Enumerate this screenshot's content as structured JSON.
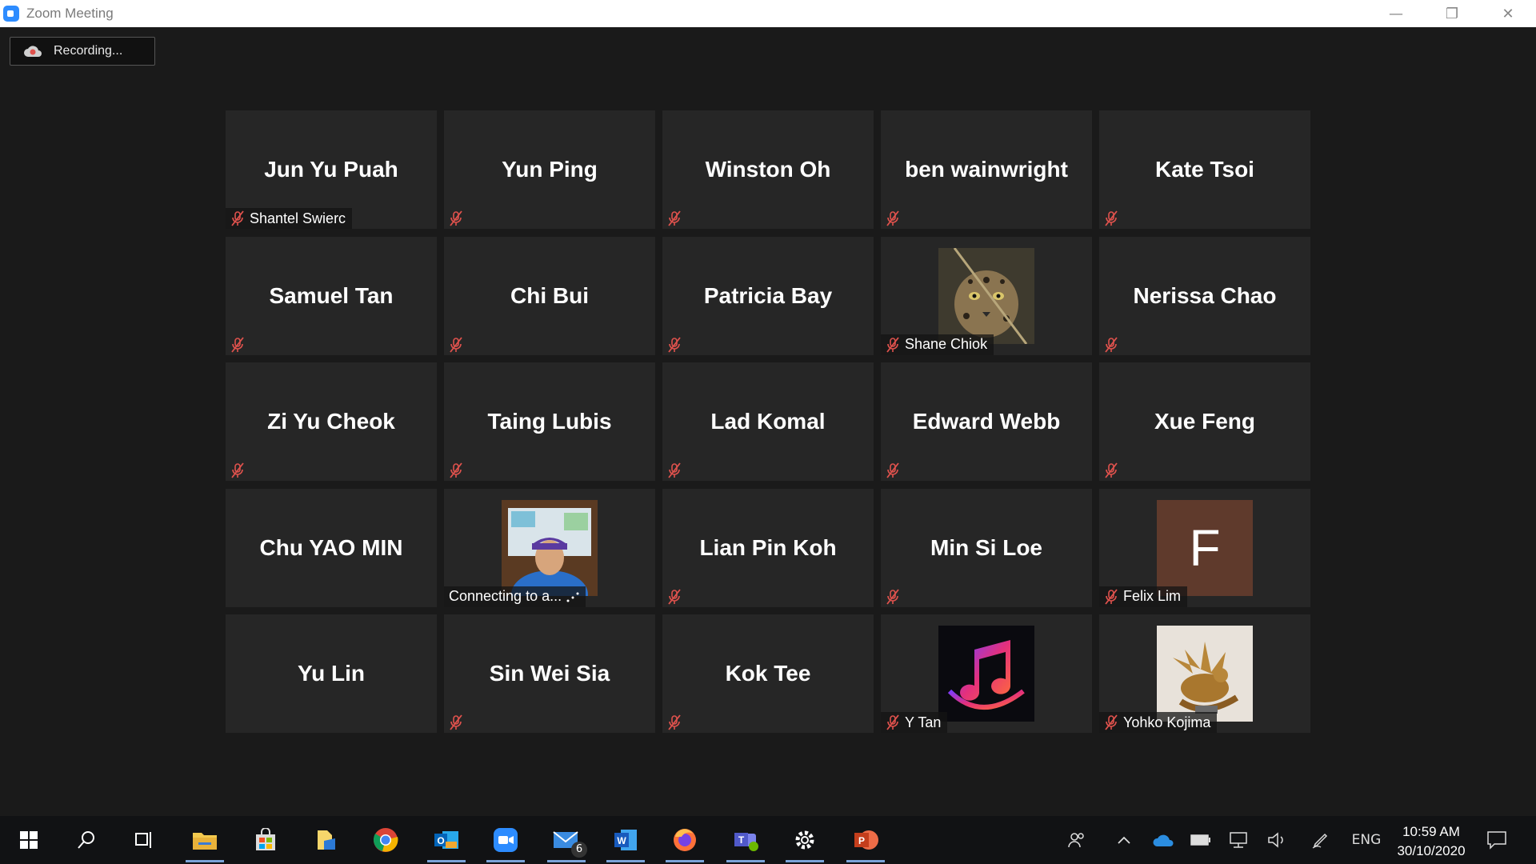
{
  "window": {
    "title": "Zoom Meeting",
    "minimize": "—",
    "restore": "❐",
    "close": "✕"
  },
  "recording": {
    "label": "Recording..."
  },
  "participants": [
    {
      "name": "Jun Yu Puah",
      "badge": "Shantel Swierc",
      "muted": true
    },
    {
      "name": "Yun Ping",
      "badge": "",
      "muted": true
    },
    {
      "name": "Winston Oh",
      "badge": "",
      "muted": true
    },
    {
      "name": "ben wainwright",
      "badge": "",
      "muted": true
    },
    {
      "name": "Kate Tsoi",
      "badge": "",
      "muted": true
    },
    {
      "name": "Samuel Tan",
      "badge": "",
      "muted": true
    },
    {
      "name": "Chi Bui",
      "badge": "",
      "muted": true
    },
    {
      "name": "Patricia Bay",
      "badge": "",
      "muted": true
    },
    {
      "name": "",
      "badge": "Shane Chiok",
      "muted": true,
      "photo": "ocelot-photo"
    },
    {
      "name": "Nerissa Chao",
      "badge": "",
      "muted": true
    },
    {
      "name": "Zi Yu Cheok",
      "badge": "",
      "muted": true
    },
    {
      "name": "Taing Lubis",
      "badge": "",
      "muted": true
    },
    {
      "name": "Lad Komal",
      "badge": "",
      "muted": true
    },
    {
      "name": "Edward Webb",
      "badge": "",
      "muted": true
    },
    {
      "name": "Xue Feng",
      "badge": "",
      "muted": true
    },
    {
      "name": "Chu YAO MIN",
      "badge": "",
      "muted": false
    },
    {
      "name": "",
      "badge": "Connecting to a...",
      "muted": false,
      "photo": "person-photo"
    },
    {
      "name": "Lian Pin Koh",
      "badge": "",
      "muted": true
    },
    {
      "name": "Min Si Loe",
      "badge": "",
      "muted": true
    },
    {
      "name": "",
      "badge": "Felix Lim",
      "muted": true,
      "photo": "avatar-letter",
      "letter": "F"
    },
    {
      "name": "Yu Lin",
      "badge": "",
      "muted": false
    },
    {
      "name": "Sin Wei Sia",
      "badge": "",
      "muted": true
    },
    {
      "name": "Kok Tee",
      "badge": "",
      "muted": true
    },
    {
      "name": "",
      "badge": "Y Tan",
      "muted": true,
      "photo": "music-note-photo"
    },
    {
      "name": "",
      "badge": "Yohko Kojima",
      "muted": true,
      "photo": "dragon-photo"
    }
  ],
  "taskbar": {
    "mail_count": "6",
    "language": "ENG",
    "time": "10:59 AM",
    "date": "30/10/2020"
  },
  "colors": {
    "tile_bg": "#262626",
    "meeting_bg": "#1a1a1a",
    "mute_red": "#e0524d",
    "avatar_brown": "#5f3a2c"
  }
}
